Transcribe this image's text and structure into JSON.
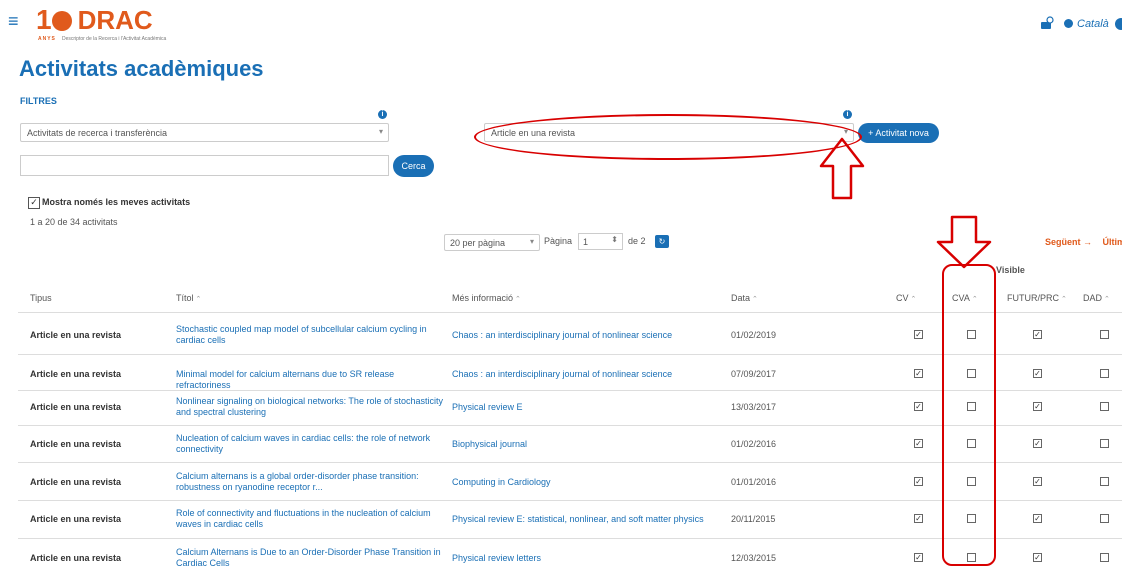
{
  "header": {
    "logo_ten": "1",
    "logo_brand": "DRAC",
    "logo_anys": "ANYS",
    "logo_subtitle": "Descriptor de la Recerca i l'Activitat Acadèmica",
    "language": "Català",
    "menu_icon": "hamburger-icon",
    "user_icon": "user-icon",
    "lang_icon": "globe-icon"
  },
  "page_title": "Activitats acadèmiques",
  "filters": {
    "label": "FILTRES",
    "category_value": "Activitats de recerca i transferència",
    "type_value": "Article en una revista",
    "new_activity_label": "+ Activitat nova",
    "search_value": "",
    "search_label": "Cerca",
    "only_mine_label": "Mostra només les meves activitats",
    "only_mine_checked": true
  },
  "results": {
    "count_text": "1 a 20 de 34 activitats",
    "per_page": "20 per pàgina",
    "page_label": "Pàgina",
    "page_value": "1",
    "page_total": "de 2",
    "next_label": "Següent →",
    "last_label": "Últim"
  },
  "table": {
    "visible_group_label": "Visible",
    "headers": {
      "tipus": "Tipus",
      "titol": "Títol",
      "mes": "Més informació",
      "data": "Data",
      "cv": "CV",
      "cva": "CVA",
      "futur": "FUTUR/PRC",
      "dad": "DAD"
    },
    "rows": [
      {
        "tipus": "Article en una revista",
        "titol": "Stochastic coupled map model of subcellular calcium cycling in cardiac cells",
        "mes": "Chaos : an interdisciplinary journal of nonlinear science",
        "data": "01/02/2019",
        "cv": true,
        "cva": false,
        "futur": true,
        "dad": false
      },
      {
        "tipus": "Article en una revista",
        "titol": "Minimal model for calcium alternans due to SR release refractoriness",
        "mes": "Chaos : an interdisciplinary journal of nonlinear science",
        "data": "07/09/2017",
        "cv": true,
        "cva": false,
        "futur": true,
        "dad": false
      },
      {
        "tipus": "Article en una revista",
        "titol": "Nonlinear signaling on biological networks: The role of stochasticity and spectral clustering",
        "mes": "Physical review E",
        "data": "13/03/2017",
        "cv": true,
        "cva": false,
        "futur": true,
        "dad": false
      },
      {
        "tipus": "Article en una revista",
        "titol": "Nucleation of calcium waves in cardiac cells: the role of network connectivity",
        "mes": "Biophysical journal",
        "data": "01/02/2016",
        "cv": true,
        "cva": false,
        "futur": true,
        "dad": false
      },
      {
        "tipus": "Article en una revista",
        "titol": "Calcium alternans is a global order-disorder phase transition: robustness on ryanodine receptor r...",
        "mes": "Computing in Cardiology",
        "data": "01/01/2016",
        "cv": true,
        "cva": false,
        "futur": true,
        "dad": false
      },
      {
        "tipus": "Article en una revista",
        "titol": "Role of connectivity and fluctuations in the nucleation of calcium waves in cardiac cells",
        "mes": "Physical review E: statistical, nonlinear, and soft matter physics",
        "data": "20/11/2015",
        "cv": true,
        "cva": false,
        "futur": true,
        "dad": false
      },
      {
        "tipus": "Article en una revista",
        "titol": "Calcium Alternans is Due to an Order-Disorder Phase Transition in Cardiac Cells",
        "mes": "Physical review letters",
        "data": "12/03/2015",
        "cv": true,
        "cva": false,
        "futur": true,
        "dad": false
      }
    ]
  },
  "colors": {
    "accent": "#1a6fb5",
    "brand": "#e05a1c",
    "annotation": "#d80000"
  }
}
